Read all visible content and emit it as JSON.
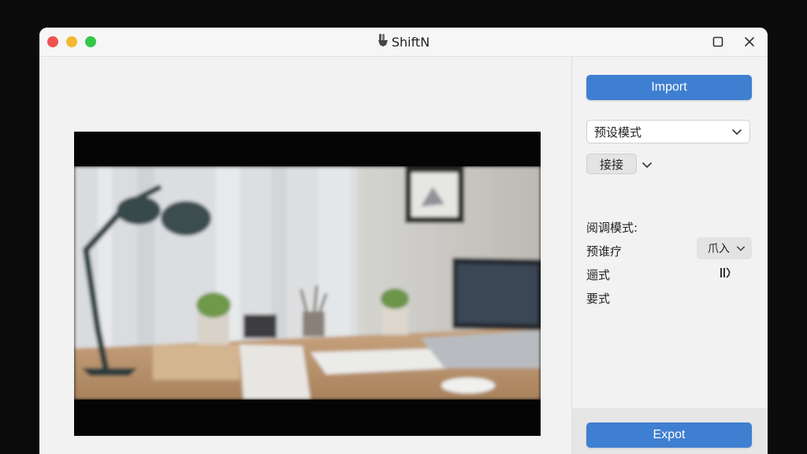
{
  "window": {
    "title": "ShiftN",
    "traffic_colors": {
      "close": "#f0534e",
      "minimize": "#f3b935",
      "maximize": "#34c749"
    }
  },
  "canvas": {
    "frame_color": "#050505"
  },
  "sidebar": {
    "import_label": "Import",
    "preset_select": {
      "value": "预设模式"
    },
    "small_button_label": "接接",
    "section_label": "阅调模式:",
    "row1_label": "预谁疗",
    "row1_select_value": "爪入",
    "row2_label": "逦式",
    "row3_label": "要式",
    "export_label": "Expot",
    "accent_color": "#3f7fd1"
  }
}
